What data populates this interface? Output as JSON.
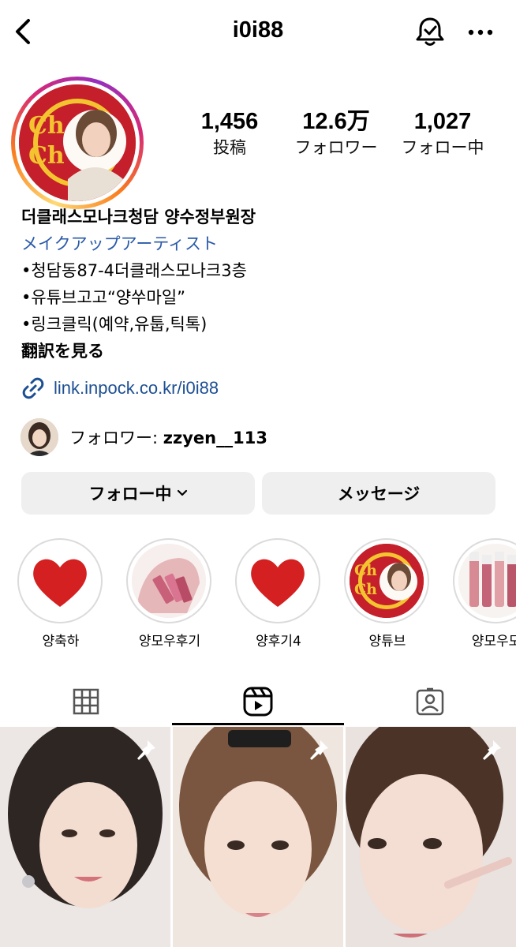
{
  "header": {
    "username": "i0i88",
    "back_icon": "chevron-left-icon",
    "bell_icon": "bell-check-icon",
    "more_icon": "more-horizontal-icon"
  },
  "stats": {
    "posts": {
      "value": "1,456",
      "label": "投稿"
    },
    "followers": {
      "value": "12.6万",
      "label": "フォロワー"
    },
    "following": {
      "value": "1,027",
      "label": "フォロー中"
    }
  },
  "bio": {
    "name": "더클래스모나크청담 양수정부원장",
    "category": "メイクアップアーティスト",
    "lines": [
      "•청담동87-4더클래스모나크3층",
      "•유튜브고고“양쑤마일”",
      "•링크클릭(예약,유툽,틱톡)"
    ],
    "translate": "翻訳を見る",
    "link": "link.inpock.co.kr/i0i88"
  },
  "followed_by": {
    "prefix": "フォロワー: ",
    "user": "zzyen__113"
  },
  "buttons": {
    "follow": "フォロー中",
    "message": "メッセージ"
  },
  "highlights": [
    {
      "label": "양축하",
      "type": "heart"
    },
    {
      "label": "양모우후기",
      "type": "lipstick-bag"
    },
    {
      "label": "양후기4",
      "type": "heart"
    },
    {
      "label": "양튜브",
      "type": "chupa-logo"
    },
    {
      "label": "양모우모",
      "type": "lip-tints"
    }
  ],
  "tabs": [
    "grid-icon",
    "reels-icon",
    "tagged-icon"
  ],
  "active_tab": "reels",
  "colors": {
    "link": "#1d4f93",
    "category": "#2a5aa8",
    "heart": "#d42020",
    "chupa_red": "#c41f2a"
  }
}
